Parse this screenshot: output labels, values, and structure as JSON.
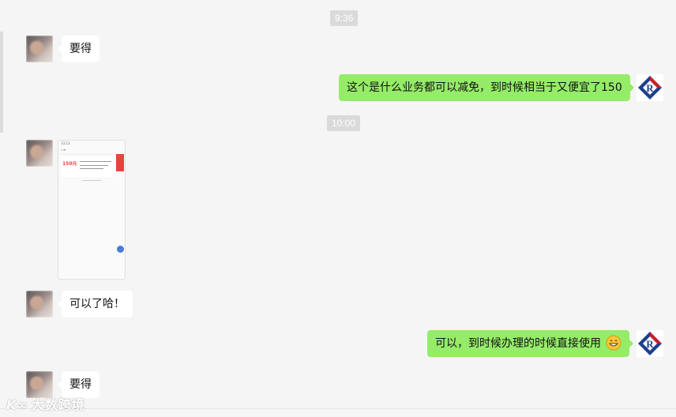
{
  "chat": {
    "timestamps": [
      "9:36",
      "10:00"
    ],
    "messages": [
      {
        "side": "left",
        "text": "要得"
      },
      {
        "side": "right",
        "text": "这个是什么业务都可以减免，到时候相当于又便宜了150"
      },
      {
        "side": "left",
        "type": "image",
        "thumb": {
          "price": "150元",
          "time": "13:13"
        }
      },
      {
        "side": "left",
        "text": "可以了哈！"
      },
      {
        "side": "right",
        "text": "可以，到时候办理的时候直接使用",
        "emoji": "grinning-face"
      },
      {
        "side": "left",
        "text": "要得"
      }
    ]
  },
  "watermark": {
    "text": "大数跨境",
    "mark": "K∞"
  }
}
